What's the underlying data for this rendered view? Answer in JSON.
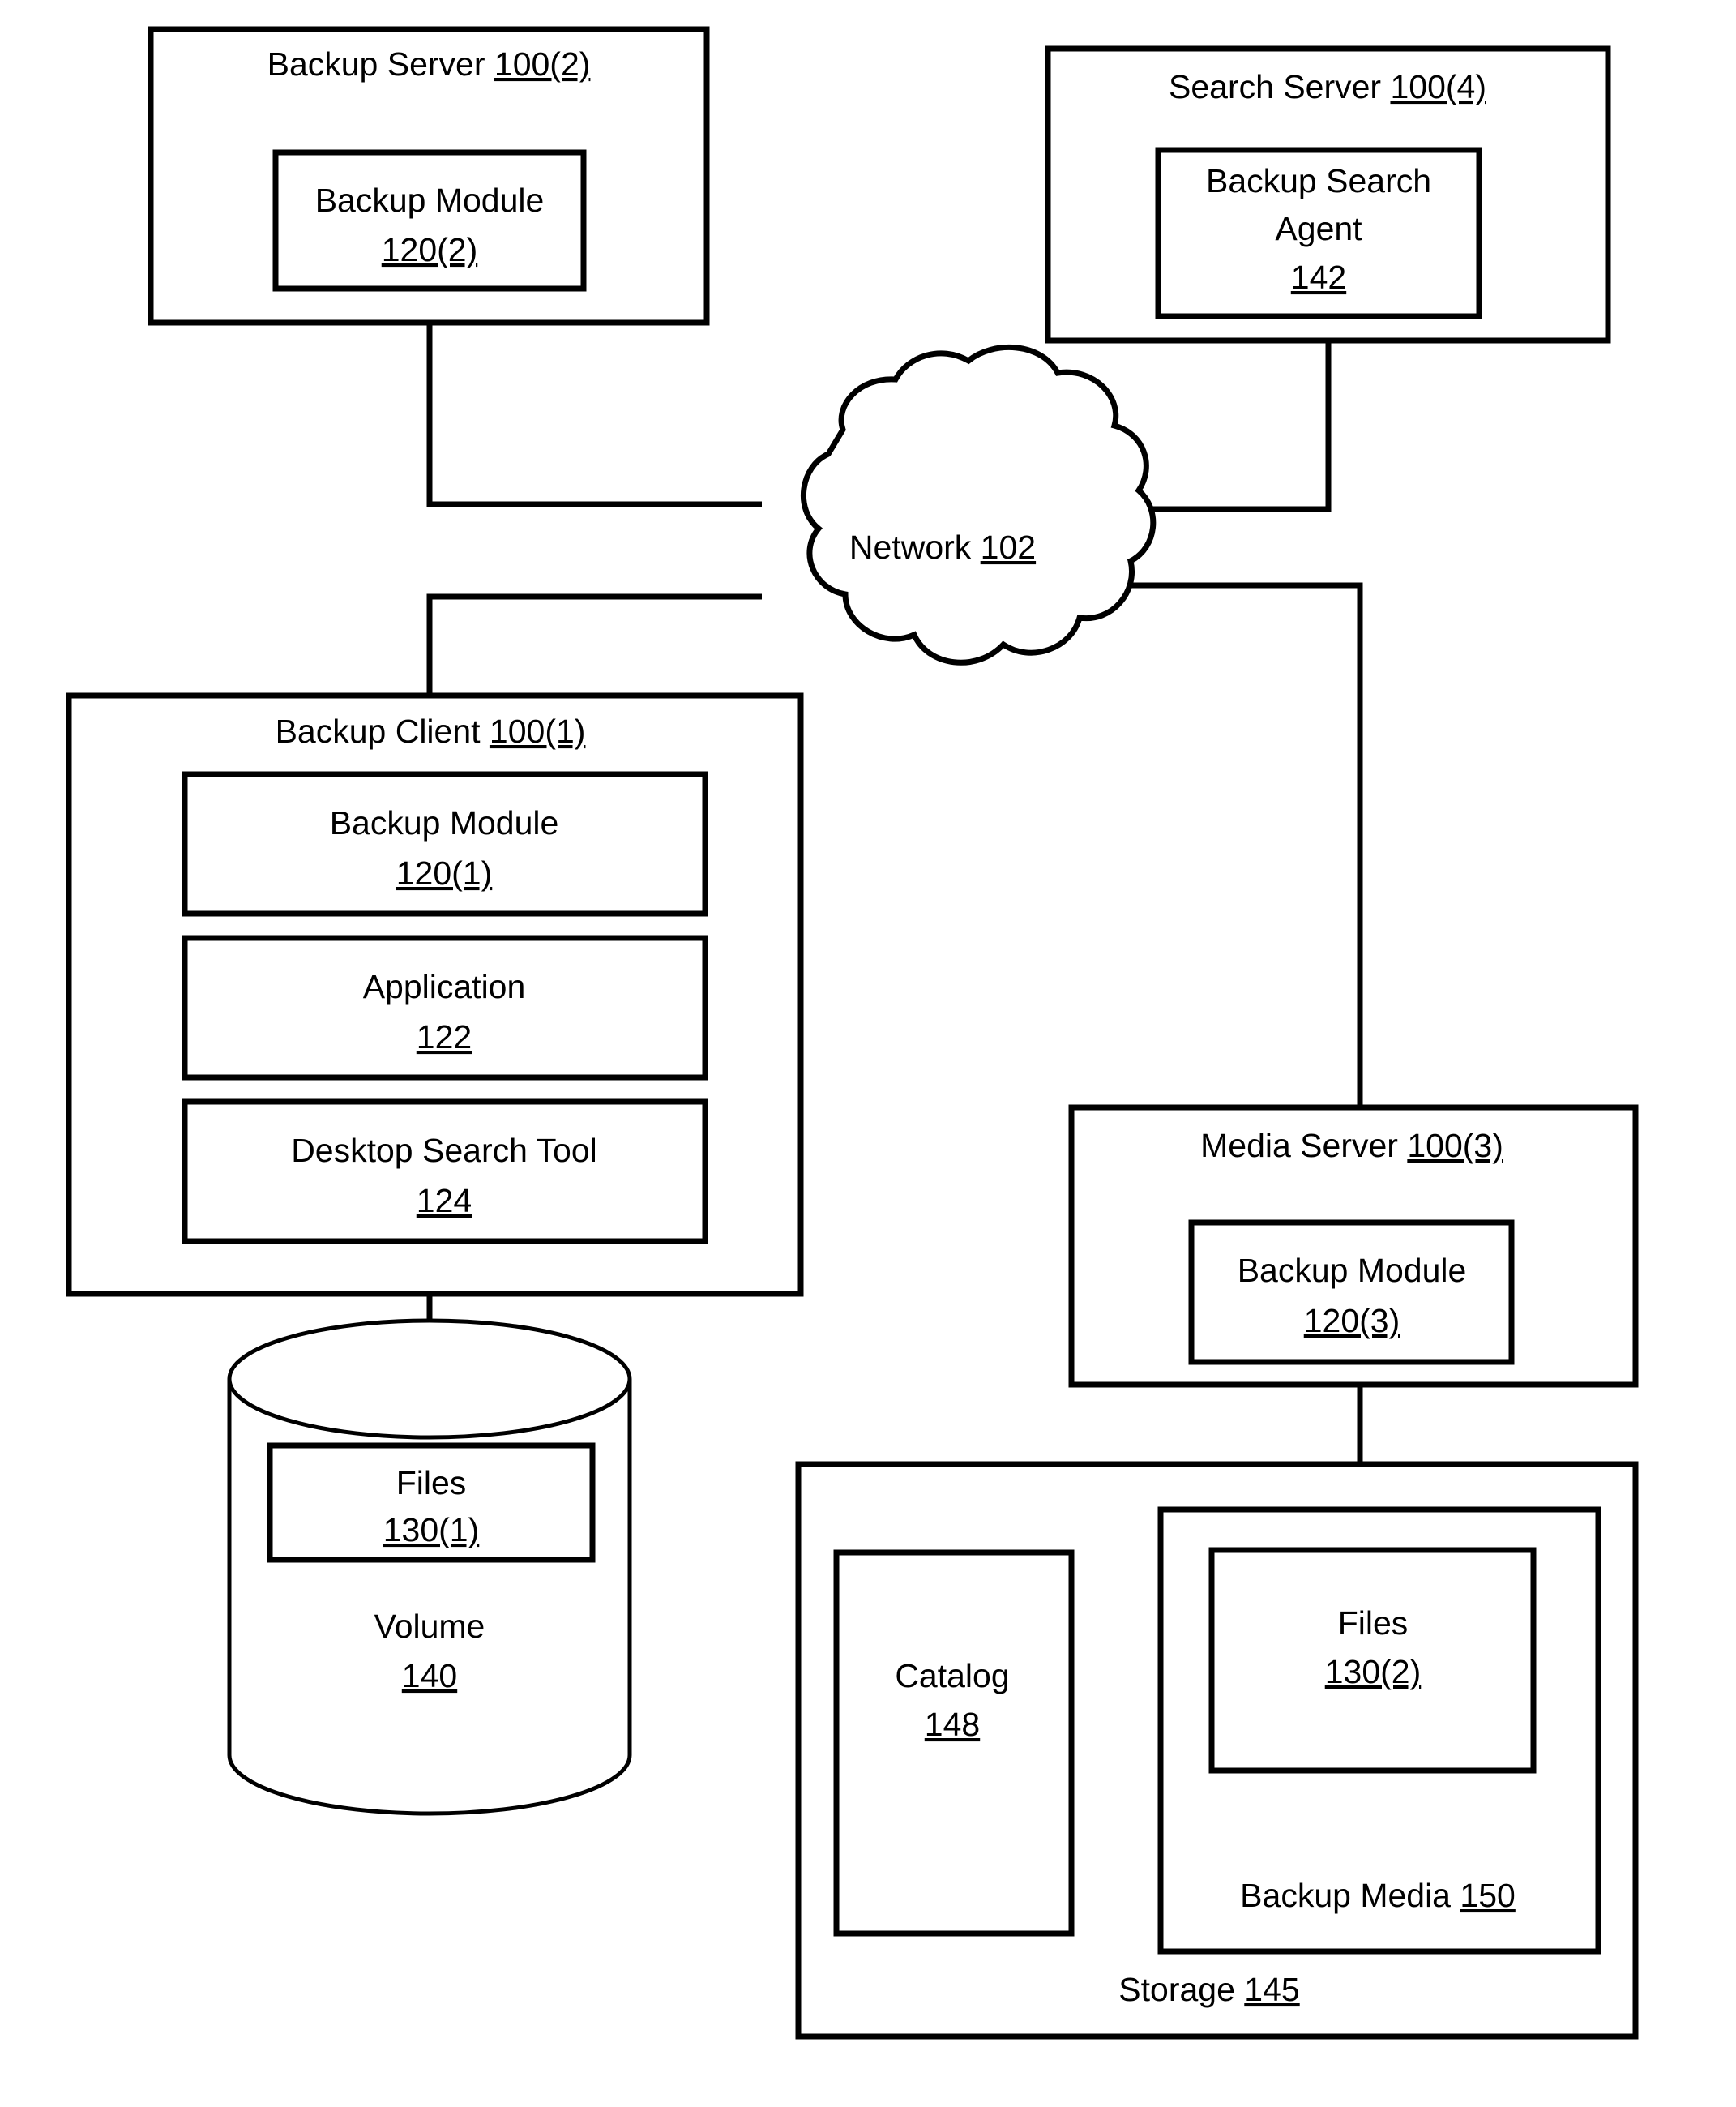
{
  "figure": {
    "type": "block-diagram",
    "background_color": "#ffffff",
    "line_color": "#000000"
  },
  "nodes": {
    "backup_server": {
      "title_text": "Backup Server ",
      "title_ref": "100(2)",
      "child": {
        "line1": "Backup Module",
        "ref": "120(2)"
      }
    },
    "search_server": {
      "title_text": "Search Server ",
      "title_ref": "100(4)",
      "child": {
        "line1": "Backup Search",
        "line2": "Agent",
        "ref": "142"
      }
    },
    "network": {
      "title_text": "Network ",
      "title_ref": "102"
    },
    "backup_client": {
      "title_text": "Backup Client ",
      "title_ref": "100(1)",
      "children": [
        {
          "line1": "Backup Module",
          "ref": "120(1)"
        },
        {
          "line1": "Application",
          "ref": "122"
        },
        {
          "line1": "Desktop Search Tool",
          "ref": "124"
        }
      ]
    },
    "volume": {
      "title_text": "Volume",
      "title_ref": "140",
      "child": {
        "line1": "Files",
        "ref": "130(1)"
      }
    },
    "media_server": {
      "title_text": "Media Server ",
      "title_ref": "100(3)",
      "child": {
        "line1": "Backup Module",
        "ref": "120(3)"
      }
    },
    "storage": {
      "title_text": "Storage ",
      "title_ref": "145",
      "catalog": {
        "line1": "Catalog",
        "ref": "148"
      },
      "backup_media": {
        "title_text": "Backup Media ",
        "title_ref": "150",
        "child": {
          "line1": "Files",
          "ref": "130(2)"
        }
      }
    }
  },
  "connections": [
    {
      "from": "backup-server",
      "to": "network"
    },
    {
      "from": "search-server",
      "to": "network"
    },
    {
      "from": "network",
      "to": "backup-client"
    },
    {
      "from": "network",
      "to": "media-server"
    },
    {
      "from": "backup-client",
      "to": "volume"
    },
    {
      "from": "media-server",
      "to": "storage"
    }
  ]
}
